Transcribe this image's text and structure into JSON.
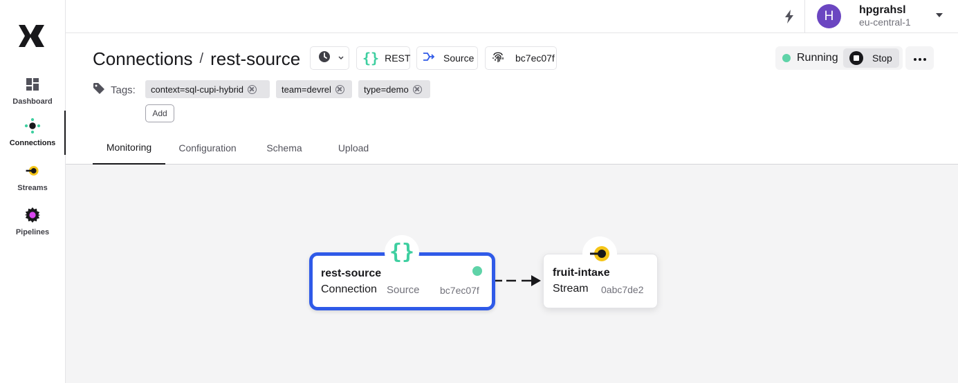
{
  "sidebar": {
    "items": [
      {
        "label": "Dashboard",
        "icon": "dashboard-icon"
      },
      {
        "label": "Connections",
        "icon": "connections-icon",
        "active": true
      },
      {
        "label": "Streams",
        "icon": "streams-icon"
      },
      {
        "label": "Pipelines",
        "icon": "pipelines-icon"
      }
    ]
  },
  "topbar": {
    "user_initial": "H",
    "user_name": "hpgrahsl",
    "user_region": "eu-central-1"
  },
  "header": {
    "breadcrumb_root": "Connections",
    "breadcrumb_sep": "/",
    "breadcrumb_current": "rest-source",
    "type_label": "REST",
    "role_label": "Source",
    "id_label": "bc7ec07f",
    "status": "Running",
    "stop_label": "Stop"
  },
  "tags": {
    "label": "Tags:",
    "items": [
      "context=sql-cupi-hybrid",
      "team=devrel",
      "type=demo"
    ],
    "add_label": "Add"
  },
  "tabs": [
    {
      "label": "Monitoring",
      "active": true
    },
    {
      "label": "Configuration"
    },
    {
      "label": "Schema"
    },
    {
      "label": "Upload"
    }
  ],
  "graph": {
    "connection": {
      "name": "rest-source",
      "kind": "Connection",
      "role": "Source",
      "id": "bc7ec07f"
    },
    "stream": {
      "name": "fruit-intake",
      "kind": "Stream",
      "id": "0abc7de2"
    }
  },
  "colors": {
    "accent": "#2f5ae8",
    "running": "#5fd3a8",
    "avatar": "#6b46c1",
    "rest": "#3ecfa0",
    "stream": "#f5c518",
    "pipeline": "#d946ef"
  }
}
